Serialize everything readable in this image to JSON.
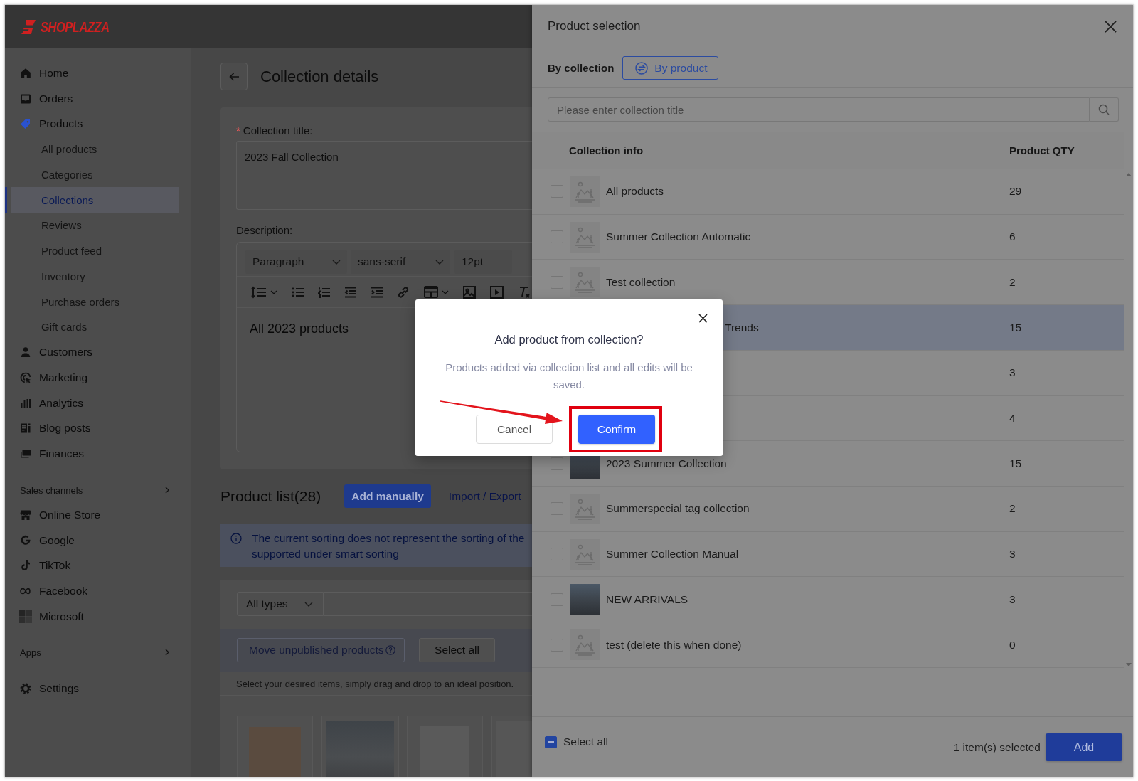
{
  "brand": {
    "name": "SHOPLAZZA"
  },
  "sidebar": {
    "groups": [
      {
        "items": [
          {
            "label": "Home",
            "selected": false
          },
          {
            "label": "Orders",
            "selected": false
          },
          {
            "label": "Products",
            "selected": true,
            "children": [
              {
                "label": "All products",
                "selected": false
              },
              {
                "label": "Categories",
                "selected": false
              },
              {
                "label": "Collections",
                "selected": true
              },
              {
                "label": "Reviews",
                "selected": false
              },
              {
                "label": "Product feed",
                "selected": false
              },
              {
                "label": "Inventory",
                "selected": false
              },
              {
                "label": "Purchase orders",
                "selected": false
              },
              {
                "label": "Gift cards",
                "selected": false
              }
            ]
          },
          {
            "label": "Customers",
            "selected": false
          },
          {
            "label": "Marketing",
            "selected": false
          },
          {
            "label": "Analytics",
            "selected": false
          },
          {
            "label": "Blog posts",
            "selected": false
          },
          {
            "label": "Finances",
            "selected": false
          }
        ]
      },
      {
        "heading": "Sales channels",
        "items": [
          {
            "label": "Online Store",
            "selected": false
          },
          {
            "label": "Google",
            "selected": false
          },
          {
            "label": "TikTok",
            "selected": false
          },
          {
            "label": "Facebook",
            "selected": false
          },
          {
            "label": "Microsoft",
            "selected": false
          }
        ]
      },
      {
        "heading": "Apps"
      },
      {
        "items": [
          {
            "label": "Settings",
            "selected": false
          }
        ]
      }
    ]
  },
  "page": {
    "title": "Collection details",
    "title_field": {
      "required_mark": "*",
      "label": "Collection title:",
      "value": "2023 Fall Collection"
    },
    "description": {
      "label": "Description:",
      "toolbar_selects": [
        {
          "kind": "dropdown",
          "value": "Paragraph"
        },
        {
          "kind": "dropdown",
          "value": "sans-serif"
        },
        {
          "kind": "input",
          "value": "12pt"
        }
      ],
      "content": "All 2023 products"
    },
    "product_list": {
      "title": "Product list(28)",
      "add_button": "Add manually",
      "import_link": "Import / Export",
      "notice_lines": [
        "The current sorting does not represent the sorting of the",
        "supported under smart sorting"
      ],
      "type_filter": "All types",
      "move_button": {
        "label": "Move unpublished products",
        "disabled": true
      },
      "select_all_button": "Select all",
      "hint": "Select your desired items, simply drag and drop to an ideal position."
    }
  },
  "drawer": {
    "title": "Product selection",
    "tabs": [
      {
        "label": "By collection",
        "selected": true
      },
      {
        "label": "By product",
        "selected": false
      }
    ],
    "search": {
      "placeholder": "Please enter collection title"
    },
    "columns": [
      "Collection info",
      "Product QTY"
    ],
    "rows": [
      {
        "kind": "placeholder",
        "name": "All products",
        "qty": "29",
        "checked": false,
        "highlighted": false
      },
      {
        "kind": "placeholder",
        "name": "Summer Collection Automatic",
        "qty": "6",
        "checked": false,
        "highlighted": false
      },
      {
        "kind": "placeholder",
        "name": "Test collection",
        "qty": "2",
        "checked": false,
        "highlighted": false
      },
      {
        "kind": "covered",
        "name": "Trends",
        "qty": "15",
        "highlighted": true
      },
      {
        "kind": "covered",
        "qty": "3",
        "highlighted": false
      },
      {
        "kind": "covered",
        "qty": "4",
        "highlighted": false
      },
      {
        "kind": "photo",
        "name": "2023 Summer Collection",
        "qty": "15",
        "checked": false,
        "highlighted": false
      },
      {
        "kind": "placeholder",
        "name": "Summerspecial tag collection",
        "qty": "2",
        "checked": false,
        "highlighted": false
      },
      {
        "kind": "placeholder",
        "name": "Summer Collection Manual",
        "qty": "3",
        "checked": false,
        "highlighted": false
      },
      {
        "kind": "photo",
        "name": "NEW ARRIVALS",
        "qty": "3",
        "checked": false,
        "highlighted": false
      },
      {
        "kind": "placeholder",
        "name": "test (delete this when done)",
        "qty": "0",
        "checked": false,
        "highlighted": false
      }
    ],
    "footer": {
      "select_all": {
        "label": "Select all",
        "indeterminate": true
      },
      "selection_count": "1 item(s) selected",
      "add_button": "Add"
    }
  },
  "dialog": {
    "title": "Add product from collection?",
    "message": "Products added via collection list and all edits will be saved.",
    "buttons": [
      {
        "label": "Cancel",
        "kind": "secondary",
        "highlighted": false
      },
      {
        "label": "Confirm",
        "kind": "primary",
        "highlighted": true
      }
    ]
  }
}
